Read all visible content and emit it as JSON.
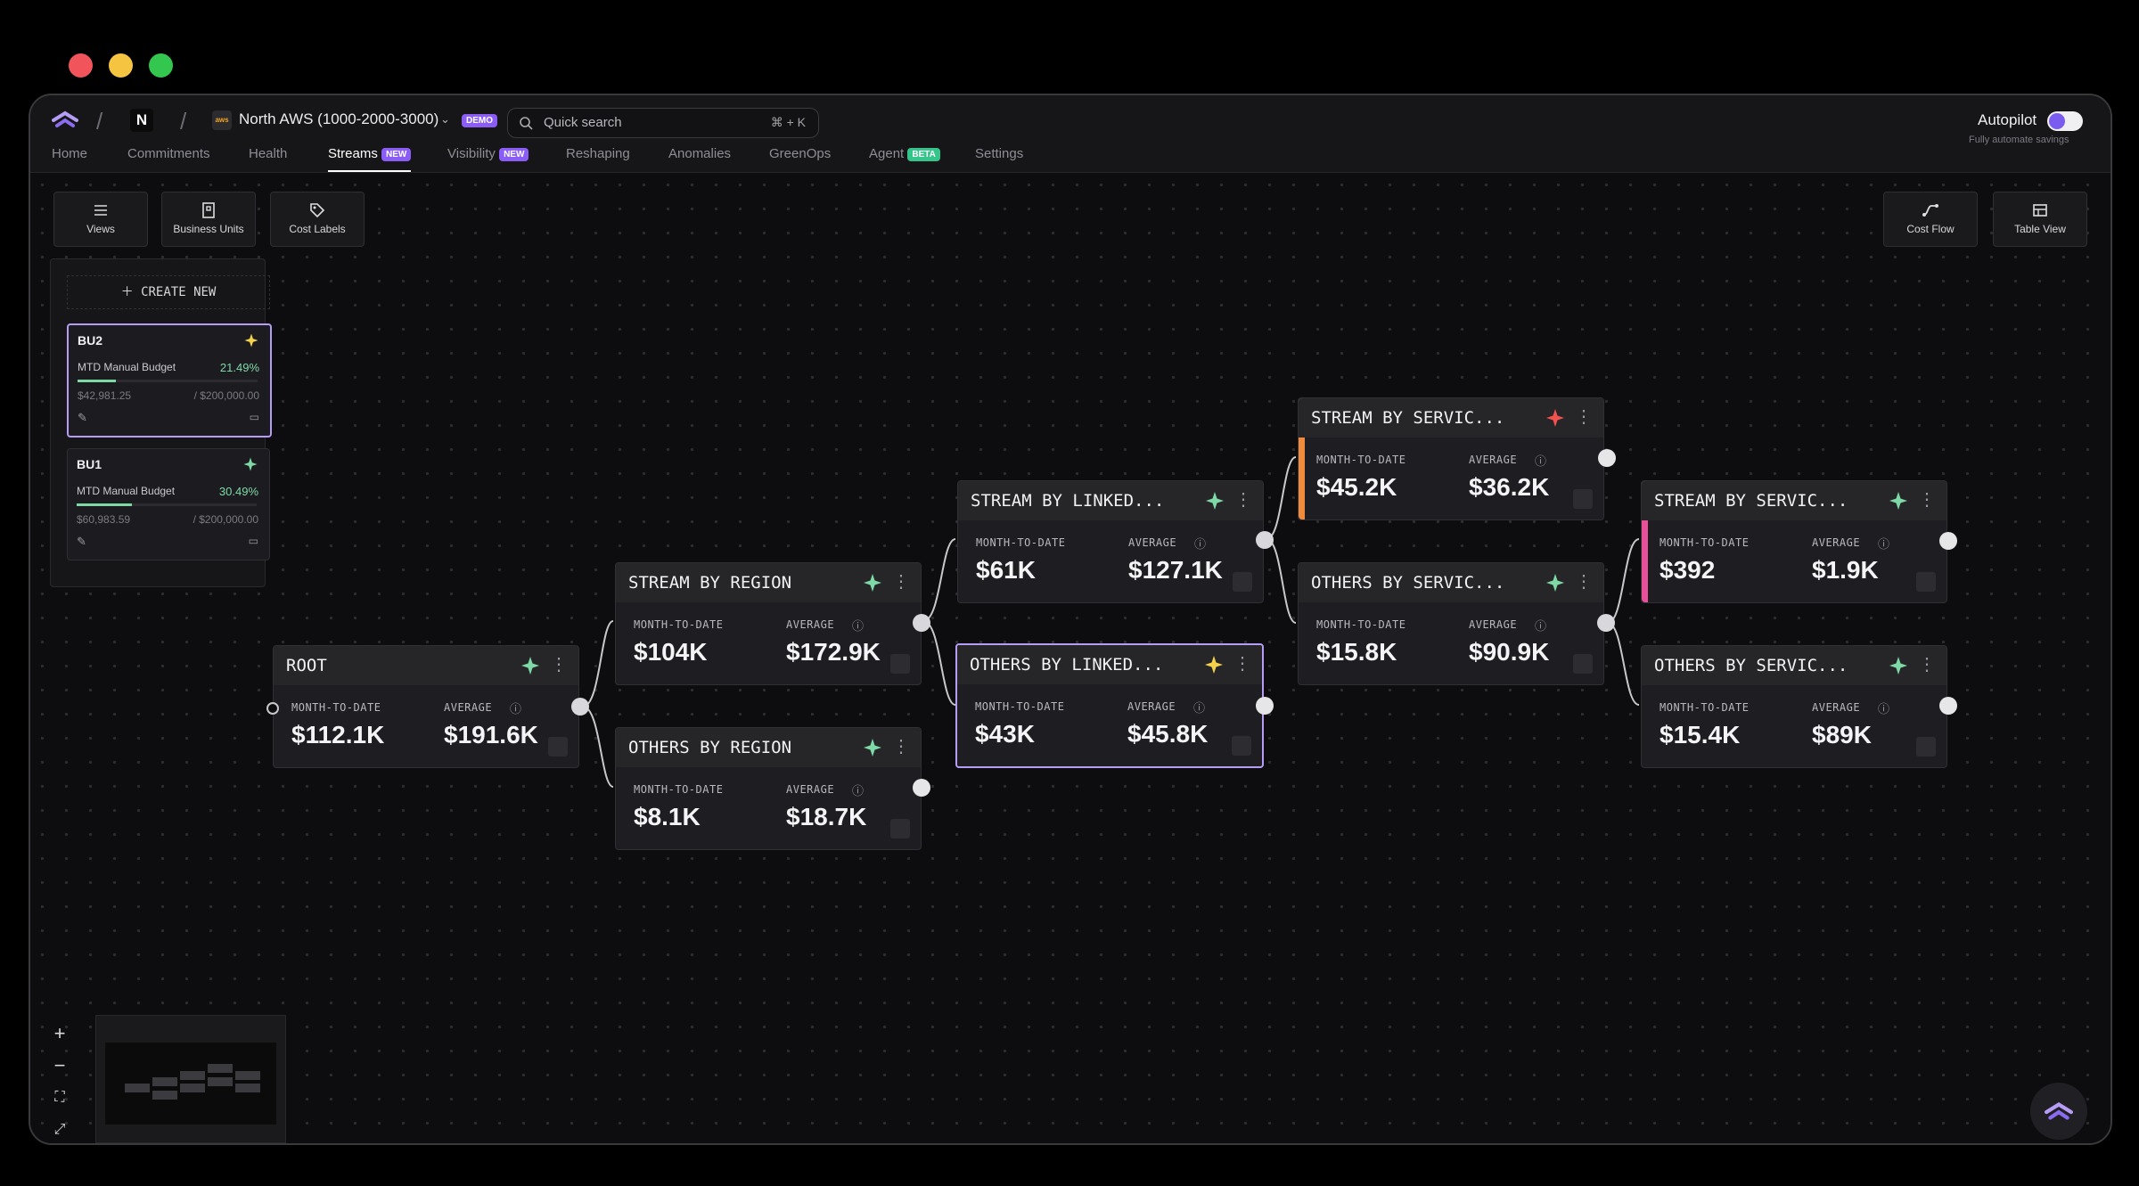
{
  "window": {
    "dots": [
      "#f2545b",
      "#f5c542",
      "#33c74f"
    ]
  },
  "header": {
    "org_initial": "N",
    "account": "North AWS (1000-2000-3000)",
    "account_badge": "DEMO",
    "search_placeholder": "Quick search",
    "search_shortcut": "⌘ + K",
    "autopilot_label": "Autopilot",
    "autopilot_sub": "Fully automate savings"
  },
  "nav": {
    "tabs": [
      {
        "label": "Home"
      },
      {
        "label": "Commitments"
      },
      {
        "label": "Health"
      },
      {
        "label": "Streams",
        "badge": "NEW",
        "active": true
      },
      {
        "label": "Visibility",
        "badge": "NEW"
      },
      {
        "label": "Reshaping"
      },
      {
        "label": "Anomalies"
      },
      {
        "label": "GreenOps"
      },
      {
        "label": "Agent",
        "badge": "BETA"
      },
      {
        "label": "Settings"
      }
    ]
  },
  "toolbar": {
    "views": "Views",
    "business_units": "Business Units",
    "cost_labels": "Cost Labels",
    "cost_flow": "Cost Flow",
    "table_view": "Table View"
  },
  "business_units": {
    "create_label": "CREATE NEW",
    "cards": [
      {
        "name": "BU2",
        "budget_label": "MTD Manual Budget",
        "percent": "21.49%",
        "spent": "$42,981.25",
        "total": "/ $200,000.00",
        "fill": 0.2149
      },
      {
        "name": "BU1",
        "budget_label": "MTD Manual Budget",
        "percent": "30.49%",
        "spent": "$60,983.59",
        "total": "/ $200,000.00",
        "fill": 0.3049
      }
    ]
  },
  "nodes": {
    "mtd_label": "MONTH-TO-DATE",
    "avg_label": "AVERAGE",
    "root": {
      "title": "ROOT",
      "mtd": "$112.1K",
      "avg": "$191.6K"
    },
    "region": {
      "title": "STREAM BY REGION",
      "mtd": "$104K",
      "avg": "$172.9K"
    },
    "others_region": {
      "title": "OTHERS BY REGION",
      "mtd": "$8.1K",
      "avg": "$18.7K"
    },
    "linked": {
      "title": "STREAM BY LINKED...",
      "mtd": "$61K",
      "avg": "$127.1K"
    },
    "others_linked": {
      "title": "OTHERS BY LINKED...",
      "mtd": "$43K",
      "avg": "$45.8K"
    },
    "service_a": {
      "title": "STREAM BY SERVIC...",
      "mtd": "$45.2K",
      "avg": "$36.2K"
    },
    "others_service_a": {
      "title": "OTHERS BY SERVIC...",
      "mtd": "$15.8K",
      "avg": "$90.9K"
    },
    "service_b": {
      "title": "STREAM BY SERVIC...",
      "mtd": "$392",
      "avg": "$1.9K"
    },
    "others_service_b": {
      "title": "OTHERS BY SERVIC...",
      "mtd": "$15.4K",
      "avg": "$89K"
    }
  },
  "colors": {
    "accent_purple": "#b79cf5",
    "green_spark": "#7ed9a6",
    "yellow_spark": "#f3d24c",
    "red_spark": "#f0524d",
    "orange_bar": "#f08a3c",
    "pink_bar": "#e8509a",
    "new_badge": "#8b5cf6",
    "beta_badge": "#35c48a"
  },
  "zoom": {
    "in": "+",
    "out": "−",
    "fit": "⛶",
    "full": "⤢"
  }
}
